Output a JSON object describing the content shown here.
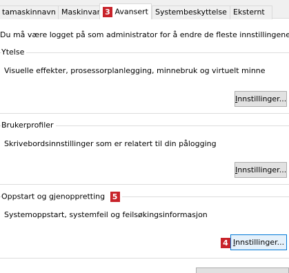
{
  "tabs": [
    {
      "label": "tamaskinnavn"
    },
    {
      "label": "Maskinvar"
    },
    {
      "label": "Avansert",
      "badge": "3"
    },
    {
      "label": "Systembeskyttelse"
    },
    {
      "label": "Eksternt"
    }
  ],
  "intro": "Du må være logget på som administrator for å endre de fleste innstillingene.",
  "groups": [
    {
      "title": "Ytelse",
      "description": "Visuelle effekter, prosessorplanlegging, minnebruk og virtuelt minne",
      "button": {
        "mnemonic": "I",
        "rest": "nnstillinger..."
      }
    },
    {
      "title": "Brukerprofiler",
      "description": "Skrivebordsinnstillinger som er relatert til din pålogging",
      "button": {
        "mnemonic": "I",
        "rest": "nnstillinger..."
      }
    },
    {
      "title": "Oppstart og gjenoppretting",
      "title_badge": "5",
      "description": "Systemoppstart, systemfeil og feilsøkingsinformasjon",
      "button": {
        "mnemonic": "I",
        "rest": "nnstillinger...",
        "badge": "4"
      }
    }
  ],
  "colors": {
    "badge": "#c8232a",
    "tab_bg": "#f0f0f0",
    "button_bg": "#e1e1e1",
    "focus_border": "#0078d7"
  }
}
